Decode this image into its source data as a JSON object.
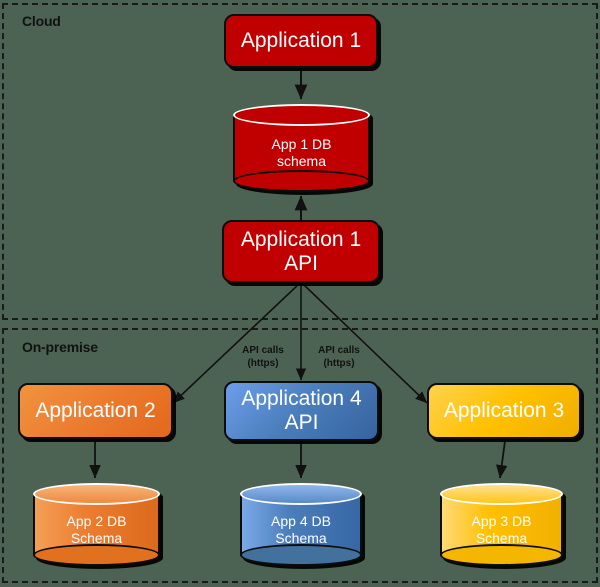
{
  "diagram": {
    "title_zones": {
      "cloud": "Cloud",
      "onpremise": "On-premise"
    },
    "colors": {
      "background": "#4c6354",
      "red": "#c00000",
      "orange": "#ed7d31",
      "blue": "#4a7ebb",
      "yellow": "#ffc000",
      "zone_border": "#1a1a1a"
    },
    "nodes": {
      "app1": {
        "label": "Application 1",
        "color": "#c00000",
        "shape": "rounded-rect",
        "zone": "Cloud"
      },
      "app1_db": {
        "label": "App 1 DB schema",
        "line1": "App 1 DB",
        "line2": "schema",
        "color": "#c00000",
        "shape": "cylinder",
        "zone": "Cloud"
      },
      "app1_api": {
        "label": "Application 1 API",
        "line1": "Application 1",
        "line2": "API",
        "color": "#c00000",
        "shape": "rounded-rect",
        "zone": "Cloud"
      },
      "app2": {
        "label": "Application 2",
        "color": "#ed7d31",
        "shape": "rounded-rect",
        "zone": "On-premise"
      },
      "app2_db": {
        "label": "App 2 DB Schema",
        "line1": "App 2 DB",
        "line2": "Schema",
        "color": "#ed7d31",
        "shape": "cylinder",
        "zone": "On-premise"
      },
      "app4_api": {
        "label": "Application 4 API",
        "line1": "Application 4",
        "line2": "API",
        "color": "#4a7ebb",
        "shape": "rounded-rect",
        "zone": "On-premise"
      },
      "app4_db": {
        "label": "App 4 DB Schema",
        "line1": "App 4 DB",
        "line2": "Schema",
        "color": "#4a7ebb",
        "shape": "cylinder",
        "zone": "On-premise"
      },
      "app3": {
        "label": "Application 3",
        "color": "#ffc000",
        "shape": "rounded-rect",
        "zone": "On-premise"
      },
      "app3_db": {
        "label": "App 3 DB Schema",
        "line1": "App 3 DB",
        "line2": "Schema",
        "color": "#ffc000",
        "shape": "cylinder",
        "zone": "On-premise"
      }
    },
    "edges": [
      {
        "id": "e1",
        "from": "app1",
        "to": "app1_db",
        "label": ""
      },
      {
        "id": "e2",
        "from": "app1_api",
        "to": "app1_db",
        "label": ""
      },
      {
        "id": "e3",
        "from": "app1_api",
        "to": "app2",
        "label": "API calls (https)",
        "line1": "API calls",
        "line2": "(https)"
      },
      {
        "id": "e4",
        "from": "app1_api",
        "to": "app4_api",
        "label": "API calls (https)",
        "line1": "API calls",
        "line2": "(https)"
      },
      {
        "id": "e5",
        "from": "app1_api",
        "to": "app3",
        "label": ""
      },
      {
        "id": "e6",
        "from": "app2",
        "to": "app2_db",
        "label": ""
      },
      {
        "id": "e7",
        "from": "app4_api",
        "to": "app4_db",
        "label": ""
      },
      {
        "id": "e8",
        "from": "app3",
        "to": "app3_db",
        "label": ""
      }
    ],
    "edge_labels": {
      "left": {
        "line1": "API calls",
        "line2": "(https)"
      },
      "right": {
        "line1": "API calls",
        "line2": "(https)"
      }
    }
  }
}
